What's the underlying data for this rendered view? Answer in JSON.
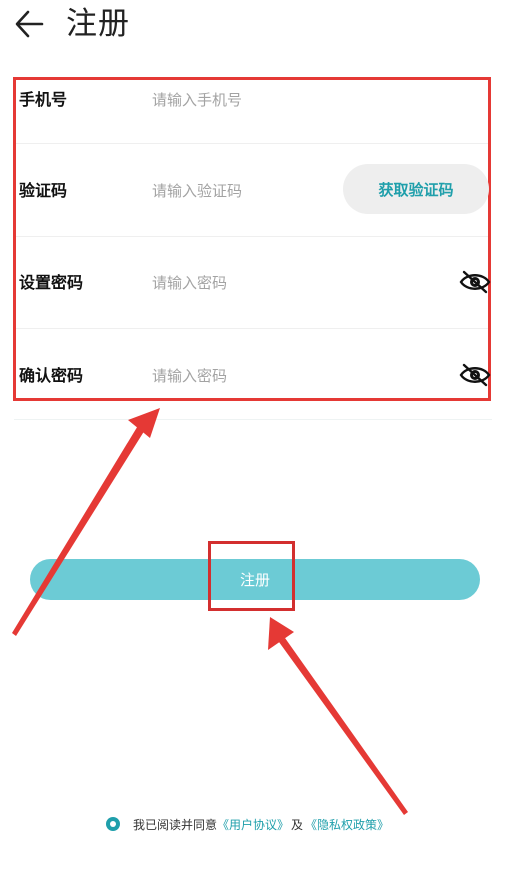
{
  "header": {
    "title": "注册",
    "back_icon": "arrow-left-icon"
  },
  "form": {
    "phone": {
      "label": "手机号",
      "placeholder": "请输入手机号"
    },
    "code": {
      "label": "验证码",
      "placeholder": "请输入验证码",
      "button_label": "获取验证码"
    },
    "password": {
      "label": "设置密码",
      "placeholder": "请输入密码",
      "toggle_icon": "eye-off-icon"
    },
    "confirm": {
      "label": "确认密码",
      "placeholder": "请输入密码",
      "toggle_icon": "eye-off-icon"
    }
  },
  "register_button": {
    "label": "注册"
  },
  "agreement": {
    "prefix": "我已阅读并同意",
    "user_link": "《用户协议》",
    "joiner": "及",
    "privacy_link": "《隐私权政策》"
  },
  "colors": {
    "accent": "#1f9fab",
    "button": "#6ccbd5",
    "annotation_red": "#e53935"
  }
}
